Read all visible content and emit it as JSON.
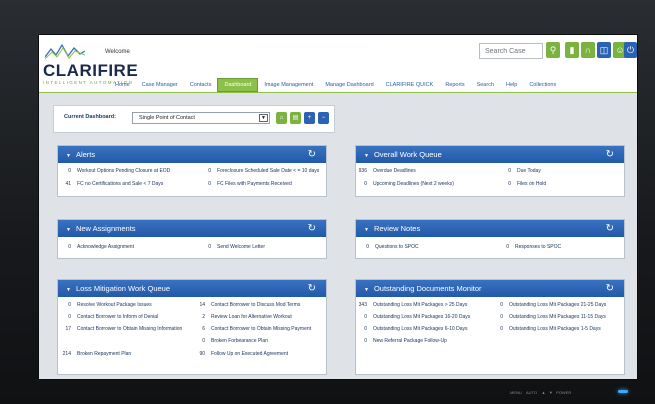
{
  "header": {
    "welcome": "Welcome",
    "logo": "CLARIFIRE",
    "logo_sub": "INTELLIGENT AUTOMATION",
    "search_placeholder": "Search Case"
  },
  "nav": [
    "Home",
    "Case Manager",
    "Contacts",
    "Dashboard",
    "Image Management",
    "Manage Dashboard",
    "CLARIFIRE QUICK",
    "Reports",
    "Search",
    "Help",
    "Collections"
  ],
  "dashboard": {
    "label": "Current Dashboard:",
    "selected": "Single Point of Contact"
  },
  "panels": {
    "alerts": {
      "title": "Alerts",
      "rows": [
        {
          "n": "0",
          "t": "Workout Options Pending Closure at EOD"
        },
        {
          "n": "0",
          "t": "Foreclosure Scheduled Sale Date < = 10 days"
        },
        {
          "n": "41",
          "t": "FC no Certifications and Sale < 7 Days"
        },
        {
          "n": "0",
          "t": "FC Files with Payments Received"
        }
      ]
    },
    "overall": {
      "title": "Overall Work Queue",
      "rows": [
        {
          "n": "936",
          "t": "Overdue Deadlines"
        },
        {
          "n": "0",
          "t": "Due Today"
        },
        {
          "n": "0",
          "t": "Upcoming Deadlines (Next 2 weeks)"
        },
        {
          "n": "0",
          "t": "Files on Hold"
        }
      ]
    },
    "assignments": {
      "title": "New Assignments",
      "rows": [
        {
          "n": "0",
          "t": "Acknowledge Assignment"
        },
        {
          "n": "0",
          "t": "Send Welcome Letter"
        }
      ]
    },
    "review": {
      "title": "Review Notes",
      "rows": [
        {
          "n": "0",
          "t": "Questions to SPOC"
        },
        {
          "n": "0",
          "t": "Responses to SPOC"
        }
      ]
    },
    "loss": {
      "title": "Loss Mitigation Work Queue",
      "rows": [
        {
          "n": "0",
          "t": "Resolve Workout Package Issues"
        },
        {
          "n": "14",
          "t": "Contact Borrower to Discuss Mod Terms"
        },
        {
          "n": "0",
          "t": "Contact Borrower to Inform of Denial"
        },
        {
          "n": "2",
          "t": "Review Loan for Alternative Workout"
        },
        {
          "n": "17",
          "t": "Contact Borrower to Obtain Missing Information"
        },
        {
          "n": "6",
          "t": "Contact Borrower to Obtain Missing Payment"
        },
        {
          "n": "0",
          "t": "Broken Forbearance Plan"
        },
        {
          "n": "214",
          "t": "Broken Repayment Plan"
        },
        {
          "n": "90",
          "t": "Follow Up on Executed Agreement"
        }
      ]
    },
    "docs": {
      "title": "Outstanding Documents Monitor",
      "rows": [
        {
          "n": "343",
          "t": "Outstanding Loss Mit Packages > 25 Days"
        },
        {
          "n": "0",
          "t": "Outstanding Loss Mit Packages 21-25 Days"
        },
        {
          "n": "0",
          "t": "Outstanding Loss Mit Packages 16-20 Days"
        },
        {
          "n": "0",
          "t": "Outstanding Loss Mit Packages 11-15 Days"
        },
        {
          "n": "0",
          "t": "Outstanding Loss Mit Packages 6-10 Days"
        },
        {
          "n": "0",
          "t": "Outstanding Loss Mit Packages 1-5 Days"
        },
        {
          "n": "0",
          "t": "New Referral Package Follow-Up"
        }
      ]
    }
  },
  "bezel": {
    "menu": "MENU",
    "auto": "AUTO",
    "power": "POWER"
  },
  "colors": {
    "panel_header": "#2a62b4",
    "accent_green": "#8cc04a",
    "nav_link": "#2a5ca8"
  }
}
